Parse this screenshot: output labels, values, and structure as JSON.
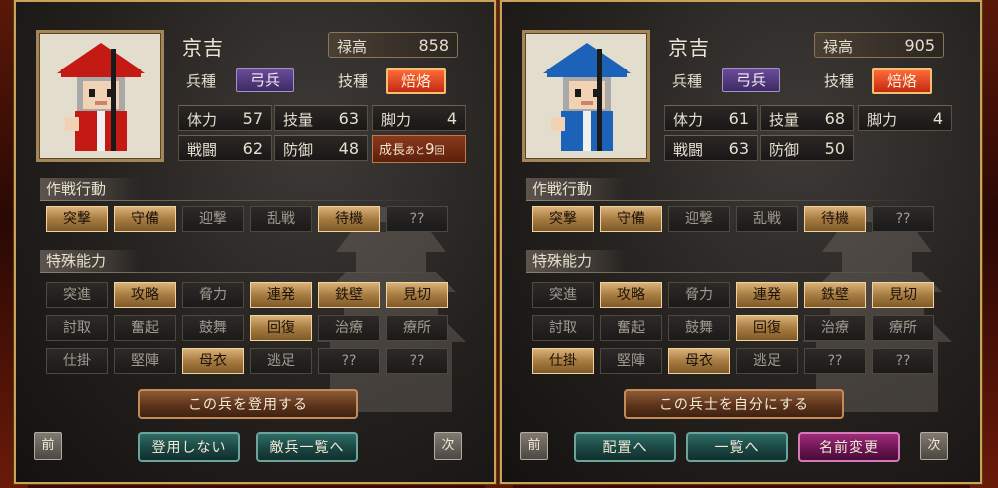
{
  "panels": {
    "left": {
      "name": "京吉",
      "salary_label": "禄高",
      "salary_value": "858",
      "unit_label": "兵種",
      "unit_value": "弓兵",
      "skill_label": "技種",
      "skill_value": "焙烙",
      "hat_color": "#c41a14",
      "stats": {
        "hp": {
          "label": "体力",
          "value": "57"
        },
        "tech": {
          "label": "技量",
          "value": "63"
        },
        "leg": {
          "label": "脚力",
          "value": "4"
        },
        "combat": {
          "label": "戦闘",
          "value": "62"
        },
        "defense": {
          "label": "防御",
          "value": "48"
        }
      },
      "growth": {
        "a": "成長",
        "b": "あと",
        "c": "9",
        "d": "回"
      },
      "tactics_title": "作戦行動",
      "tactics": [
        {
          "label": "突撃",
          "on": true
        },
        {
          "label": "守備",
          "on": true
        },
        {
          "label": "迎撃",
          "on": false
        },
        {
          "label": "乱戦",
          "on": false
        },
        {
          "label": "待機",
          "on": true
        },
        {
          "label": "??",
          "on": false
        }
      ],
      "abilities_title": "特殊能力",
      "abilities": [
        {
          "label": "突進",
          "on": false
        },
        {
          "label": "攻略",
          "on": true
        },
        {
          "label": "脅力",
          "on": false
        },
        {
          "label": "連発",
          "on": true
        },
        {
          "label": "鉄壁",
          "on": true
        },
        {
          "label": "見切",
          "on": true
        },
        {
          "label": "討取",
          "on": false
        },
        {
          "label": "奮起",
          "on": false
        },
        {
          "label": "鼓舞",
          "on": false
        },
        {
          "label": "回復",
          "on": true
        },
        {
          "label": "治療",
          "on": false
        },
        {
          "label": "療所",
          "on": false
        },
        {
          "label": "仕掛",
          "on": false
        },
        {
          "label": "堅陣",
          "on": false
        },
        {
          "label": "母衣",
          "on": true
        },
        {
          "label": "逃足",
          "on": false
        },
        {
          "label": "??",
          "on": false
        },
        {
          "label": "??",
          "on": false
        }
      ],
      "main_button": "この兵を登用する",
      "prev": "前",
      "next": "次",
      "bottom_buttons": [
        "登用しない",
        "敵兵一覧へ"
      ]
    },
    "right": {
      "name": "京吉",
      "salary_label": "禄高",
      "salary_value": "905",
      "unit_label": "兵種",
      "unit_value": "弓兵",
      "skill_label": "技種",
      "skill_value": "焙烙",
      "hat_color": "#1c62b8",
      "stats": {
        "hp": {
          "label": "体力",
          "value": "61"
        },
        "tech": {
          "label": "技量",
          "value": "68"
        },
        "leg": {
          "label": "脚力",
          "value": "4"
        },
        "combat": {
          "label": "戦闘",
          "value": "63"
        },
        "defense": {
          "label": "防御",
          "value": "50"
        }
      },
      "tactics_title": "作戦行動",
      "tactics": [
        {
          "label": "突撃",
          "on": true
        },
        {
          "label": "守備",
          "on": true
        },
        {
          "label": "迎撃",
          "on": false
        },
        {
          "label": "乱戦",
          "on": false
        },
        {
          "label": "待機",
          "on": true
        },
        {
          "label": "??",
          "on": false
        }
      ],
      "abilities_title": "特殊能力",
      "abilities": [
        {
          "label": "突進",
          "on": false
        },
        {
          "label": "攻略",
          "on": true
        },
        {
          "label": "脅力",
          "on": false
        },
        {
          "label": "連発",
          "on": true
        },
        {
          "label": "鉄壁",
          "on": true
        },
        {
          "label": "見切",
          "on": true
        },
        {
          "label": "討取",
          "on": false
        },
        {
          "label": "奮起",
          "on": false
        },
        {
          "label": "鼓舞",
          "on": false
        },
        {
          "label": "回復",
          "on": true
        },
        {
          "label": "治療",
          "on": false
        },
        {
          "label": "療所",
          "on": false
        },
        {
          "label": "仕掛",
          "on": true
        },
        {
          "label": "堅陣",
          "on": false
        },
        {
          "label": "母衣",
          "on": true
        },
        {
          "label": "逃足",
          "on": false
        },
        {
          "label": "??",
          "on": false
        },
        {
          "label": "??",
          "on": false
        }
      ],
      "main_button": "この兵士を自分にする",
      "prev": "前",
      "next": "次",
      "bottom_buttons": [
        "配置へ",
        "一覧へ",
        "名前変更"
      ]
    }
  }
}
